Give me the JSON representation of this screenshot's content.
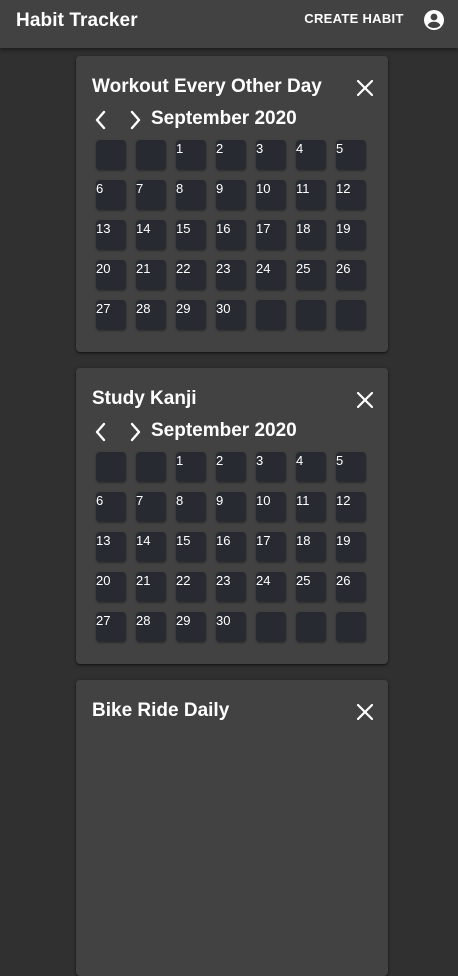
{
  "app": {
    "title": "Habit Tracker",
    "create_label": "CREATE HABIT",
    "account_icon": "account-circle-icon",
    "close_icon": "close-icon",
    "prev_icon": "chevron-left-icon",
    "next_icon": "chevron-right-icon"
  },
  "colors": {
    "background": "#303030",
    "appbar": "#424242",
    "card": "#424242",
    "day_cell": "#272a30",
    "text": "#ffffff"
  },
  "habits": [
    {
      "title": "Workout Every Other Day",
      "month": "September 2020",
      "days": [
        "",
        "",
        "1",
        "2",
        "3",
        "4",
        "5",
        "6",
        "7",
        "8",
        "9",
        "10",
        "11",
        "12",
        "13",
        "14",
        "15",
        "16",
        "17",
        "18",
        "19",
        "20",
        "21",
        "22",
        "23",
        "24",
        "25",
        "26",
        "27",
        "28",
        "29",
        "30",
        "",
        "",
        ""
      ]
    },
    {
      "title": "Study Kanji",
      "month": "September 2020",
      "days": [
        "",
        "",
        "1",
        "2",
        "3",
        "4",
        "5",
        "6",
        "7",
        "8",
        "9",
        "10",
        "11",
        "12",
        "13",
        "14",
        "15",
        "16",
        "17",
        "18",
        "19",
        "20",
        "21",
        "22",
        "23",
        "24",
        "25",
        "26",
        "27",
        "28",
        "29",
        "30",
        "",
        "",
        ""
      ]
    },
    {
      "title": "Bike Ride Daily",
      "month": "",
      "days": []
    }
  ]
}
